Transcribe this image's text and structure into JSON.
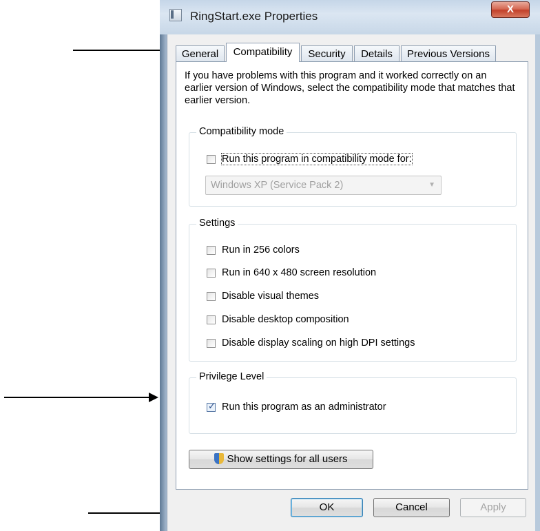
{
  "dialog": {
    "title": "RingStart.exe Properties",
    "close_glyph": "X"
  },
  "tabs": [
    {
      "label": "General",
      "active": false
    },
    {
      "label": "Compatibility",
      "active": true
    },
    {
      "label": "Security",
      "active": false
    },
    {
      "label": "Details",
      "active": false
    },
    {
      "label": "Previous Versions",
      "active": false
    }
  ],
  "compat": {
    "intro": "If you have problems with this program and it worked correctly on an earlier version of Windows, select the compatibility mode that matches that earlier version.",
    "mode_group": {
      "label": "Compatibility mode",
      "checkbox_label": "Run this program in compatibility mode for:",
      "checked": false,
      "select_value": "Windows XP (Service Pack 2)"
    },
    "settings_group": {
      "label": "Settings",
      "items": [
        {
          "label": "Run in 256 colors",
          "checked": false
        },
        {
          "label": "Run in 640 x 480 screen resolution",
          "checked": false
        },
        {
          "label": "Disable visual themes",
          "checked": false
        },
        {
          "label": "Disable desktop composition",
          "checked": false
        },
        {
          "label": "Disable display scaling on high DPI settings",
          "checked": false
        }
      ]
    },
    "privilege_group": {
      "label": "Privilege Level",
      "checkbox_label": "Run this program as an administrator",
      "checked": true
    },
    "all_users_button": "Show settings for all users"
  },
  "footer": {
    "ok": "OK",
    "cancel": "Cancel",
    "apply": "Apply"
  },
  "colors": {
    "titlebar": "#dbe6f2",
    "close_button": "#c2412a",
    "panel": "#ffffff",
    "client": "#f0f0f0"
  }
}
